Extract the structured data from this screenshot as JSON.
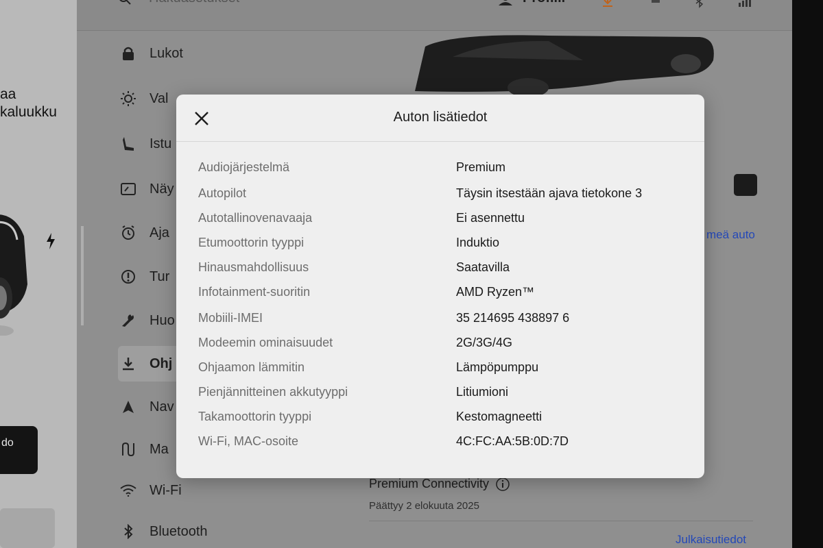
{
  "left_panel": {
    "label_top": "aa",
    "label_bottom": "kaluukku",
    "bottom_button": "do"
  },
  "top_bar": {
    "search_placeholder": "Hakuasetukset",
    "profile_label": "Profiili"
  },
  "menu": {
    "items": [
      {
        "label": "Lukot",
        "icon": "lock-icon"
      },
      {
        "label": "Val",
        "icon": "sun-icon"
      },
      {
        "label": "Istu",
        "icon": "seat-icon"
      },
      {
        "label": "Näy",
        "icon": "display-icon"
      },
      {
        "label": "Aja",
        "icon": "steering-icon"
      },
      {
        "label": "Tur",
        "icon": "alert-circle-icon"
      },
      {
        "label": "Huo",
        "icon": "wrench-icon"
      },
      {
        "label": "Ohj",
        "icon": "download-icon",
        "active": true
      },
      {
        "label": "Nav",
        "icon": "navigation-arrow-icon"
      },
      {
        "label": "Ma",
        "icon": "map-icon"
      },
      {
        "label": "Wi-Fi",
        "icon": "wifi-icon"
      },
      {
        "label": "Bluetooth",
        "icon": "bluetooth-icon"
      }
    ]
  },
  "content": {
    "link_right": "meä auto",
    "premium_title": "Premium Connectivity",
    "premium_subtitle": "Päättyy 2 elokuuta 2025",
    "release_notes_link": "Julkaisutiedot"
  },
  "modal": {
    "title": "Auton lisätiedot",
    "rows": [
      {
        "label": "Audiojärjestelmä",
        "value": "Premium"
      },
      {
        "label": "Autopilot",
        "value": "Täysin itsestään ajava tietokone 3"
      },
      {
        "label": "Autotallinovenavaaja",
        "value": "Ei asennettu"
      },
      {
        "label": "Etumoottorin tyyppi",
        "value": "Induktio"
      },
      {
        "label": "Hinausmahdollisuus",
        "value": "Saatavilla"
      },
      {
        "label": "Infotainment-suoritin",
        "value": "AMD Ryzen™"
      },
      {
        "label": "Mobiili-IMEI",
        "value": "35 214695 438897 6"
      },
      {
        "label": "Modeemin ominaisuudet",
        "value": "2G/3G/4G"
      },
      {
        "label": "Ohjaamon lämmitin",
        "value": "Lämpöpumppu"
      },
      {
        "label": "Pienjännitteinen akkutyyppi",
        "value": "Litiumioni"
      },
      {
        "label": "Takamoottorin tyyppi",
        "value": "Kestomagneetti"
      },
      {
        "label": "Wi-Fi, MAC-osoite",
        "value": "4C:FC:AA:5B:0D:7D"
      }
    ]
  },
  "colors": {
    "accent_link": "#2448b8",
    "modal_bg": "#efefef",
    "screen_dim": "#8f8f8f"
  }
}
